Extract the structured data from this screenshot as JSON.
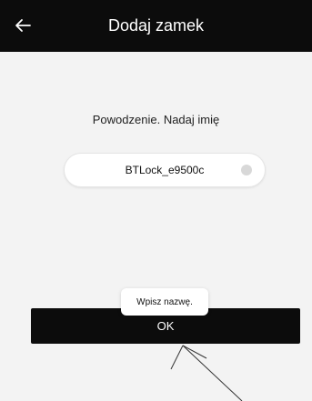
{
  "header": {
    "title": "Dodaj zamek",
    "back_icon": "arrow-left-icon"
  },
  "main": {
    "prompt": "Powodzenie. Nadaj imię",
    "name_field": {
      "value": "BTLock_e9500c",
      "clear_icon": "clear-icon"
    },
    "ok_button_label": "OK"
  },
  "toast": {
    "text": "Wpisz nazwę."
  },
  "colors": {
    "header_bg": "#0c0c0c",
    "page_bg": "#f3f3f3",
    "button_bg": "#0c0c0c",
    "text": "#222222"
  }
}
